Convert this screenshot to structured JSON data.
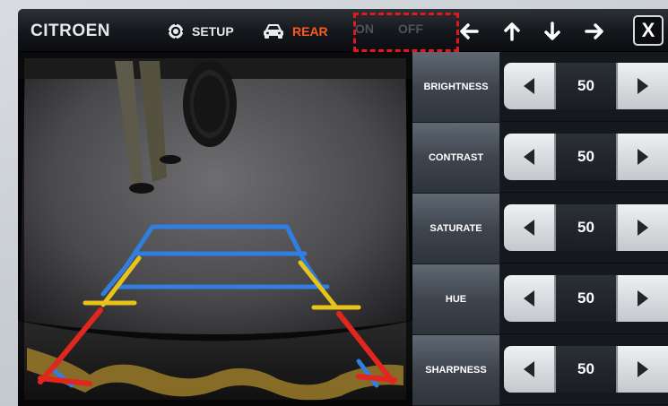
{
  "topbar": {
    "brand": "CITROEN",
    "setup_label": "SETUP",
    "rear_label": "REAR",
    "on_label": "ON",
    "off_label": "OFF",
    "close_label": "X",
    "arrows": [
      "arrow-left-icon",
      "arrow-up-icon",
      "arrow-down-icon",
      "arrow-right-icon"
    ]
  },
  "colors": {
    "accent_rear": "#ff5a1e",
    "highlight_box": "#e0191e",
    "guide_blue": "#2f7ee0",
    "guide_yellow": "#e8c31a",
    "guide_red": "#e0261e"
  },
  "settings": [
    {
      "label": "BRIGHTNESS",
      "value": "50"
    },
    {
      "label": "CONTRAST",
      "value": "50"
    },
    {
      "label": "SATURATE",
      "value": "50"
    },
    {
      "label": "HUE",
      "value": "50"
    },
    {
      "label": "SHARPNESS",
      "value": "50"
    }
  ]
}
